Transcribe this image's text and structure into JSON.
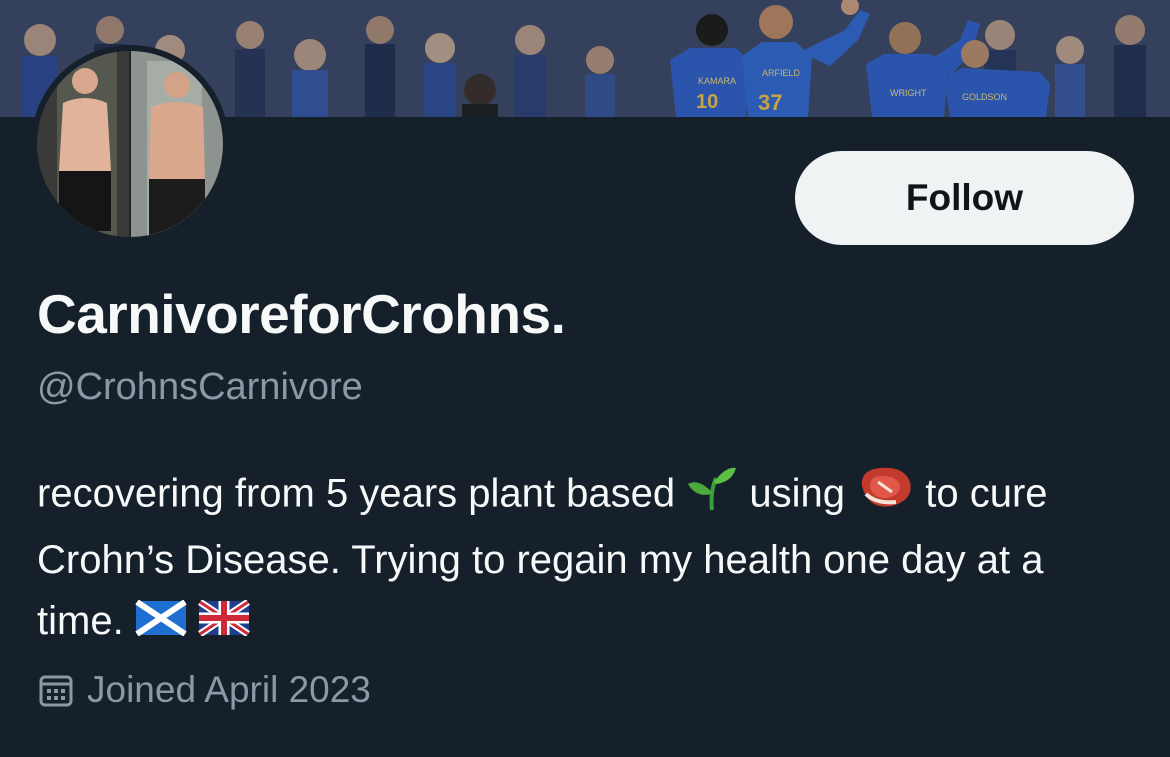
{
  "profile": {
    "display_name": "CarnivoreforCrohns.",
    "handle": "@CrohnsCarnivore",
    "bio": {
      "part1": "recovering from 5 years plant based",
      "emoji1": "seedling",
      "part2": "using",
      "emoji2": "cut-of-meat",
      "part3": "to cure Crohn’s Disease. Trying to regain my health one day at a time.",
      "emoji3": "scotland-flag",
      "emoji4": "uk-flag"
    },
    "joined": "Joined April 2023"
  },
  "actions": {
    "follow_label": "Follow"
  },
  "banner": {
    "jersey_numbers": [
      "10",
      "37"
    ],
    "jersey_names": [
      "KAMARA",
      "ARFIELD",
      "WRIGHT",
      "GOLDSON"
    ]
  },
  "colors": {
    "background": "#15202b",
    "primary_text": "#f7f9f9",
    "secondary_text": "#8b98a5",
    "button_bg": "#eff3f4",
    "jersey_blue": "#2f5fc4"
  }
}
